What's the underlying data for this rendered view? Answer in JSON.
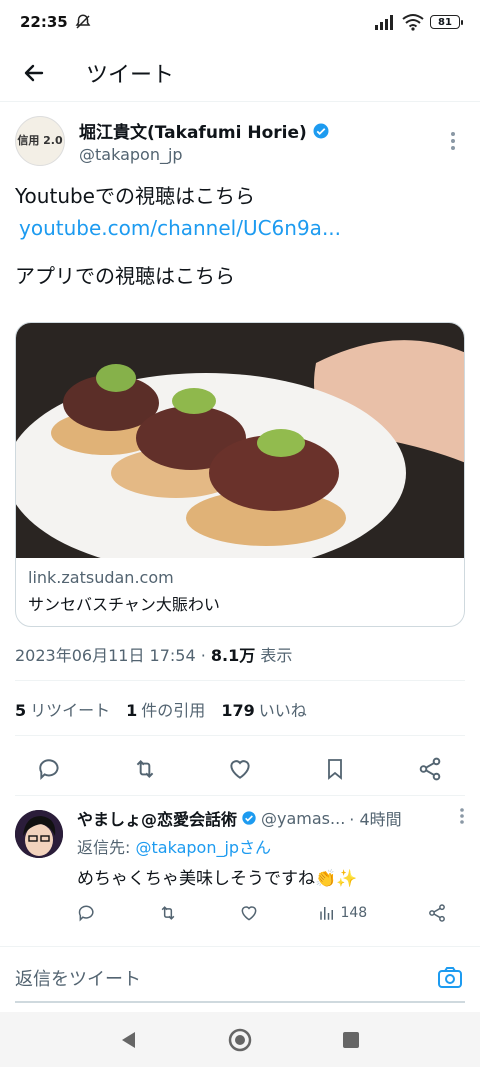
{
  "status_bar": {
    "time": "22:35",
    "battery": "81"
  },
  "header": {
    "title": "ツイート"
  },
  "tweet": {
    "author_name": "堀江貴文(Takafumi Horie)",
    "author_handle": "@takapon_jp",
    "avatar_text": "信用 2.0",
    "text_line1": "Youtubeでの視聴はこちら",
    "link": "youtube.com/channel/UC6n9a...",
    "text_line2": "アプリでの視聴はこちら",
    "card": {
      "domain": "link.zatsudan.com",
      "title": "サンセバスチャン大賑わい"
    },
    "timestamp": "2023年06月11日 17:54",
    "views_count": "8.1万",
    "views_label": "表示",
    "stats": {
      "retweets_count": "5",
      "retweets_label": "リツイート",
      "quotes_count": "1",
      "quotes_label": "件の引用",
      "likes_count": "179",
      "likes_label": "いいね"
    }
  },
  "reply": {
    "name": "やましょ@恋愛会話術",
    "handle": "@yamas...",
    "time": "· 4時間",
    "reply_to_prefix": "返信先:",
    "reply_to_user": "@takapon_jpさん",
    "text": "めちゃくちゃ美味しそうですね👏✨",
    "views": "148"
  },
  "compose": {
    "placeholder": "返信をツイート"
  },
  "colors": {
    "accent": "#1d9bf0",
    "muted": "#536471"
  }
}
